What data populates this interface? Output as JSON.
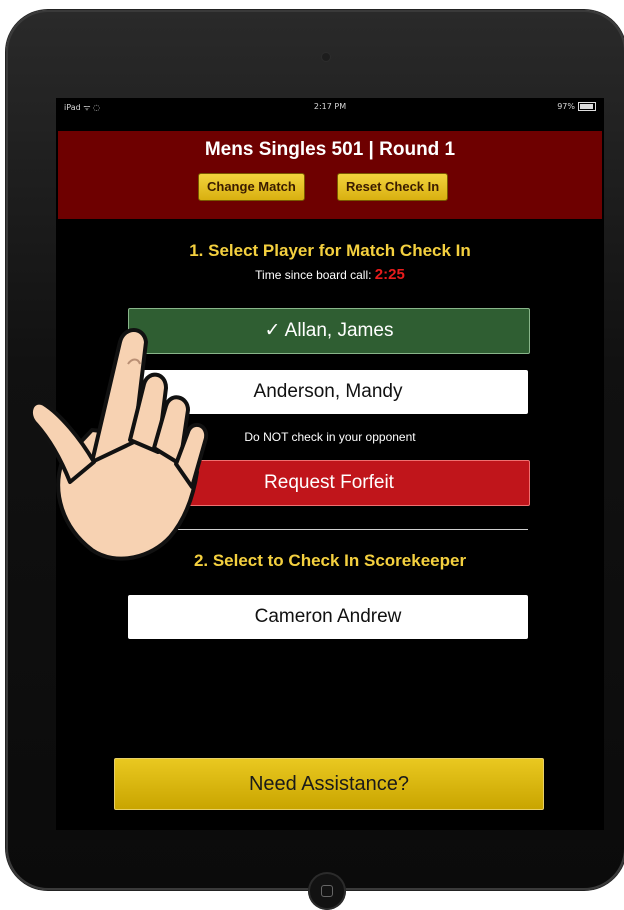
{
  "status_bar": {
    "device": "iPad ᯤ ◌",
    "time": "2:17 PM",
    "battery": "97%"
  },
  "header": {
    "title": "Mens Singles 501 | Round 1",
    "change_match_label": "Change Match",
    "reset_checkin_label": "Reset Check In"
  },
  "section1": {
    "title": "1. Select Player for Match Check In",
    "timer_label": "Time since board call:",
    "timer_value": "2:25",
    "players": [
      {
        "label": "✓ Allan, James",
        "checked": true
      },
      {
        "label": "Anderson, Mandy",
        "checked": false
      }
    ],
    "warning": "Do NOT check in your opponent",
    "forfeit_label": "Request Forfeit"
  },
  "section2": {
    "title": "2. Select to Check In Scorekeeper",
    "scorekeeper_label": "Cameron Andrew"
  },
  "assist_label": "Need Assistance?",
  "colors": {
    "header_bg": "#6e0000",
    "title_yellow": "#f4d03f",
    "checked_green": "#2f5e32",
    "forfeit_red": "#c0151b",
    "timer_red": "#e81c1c",
    "gold_button": "#d9b010"
  }
}
